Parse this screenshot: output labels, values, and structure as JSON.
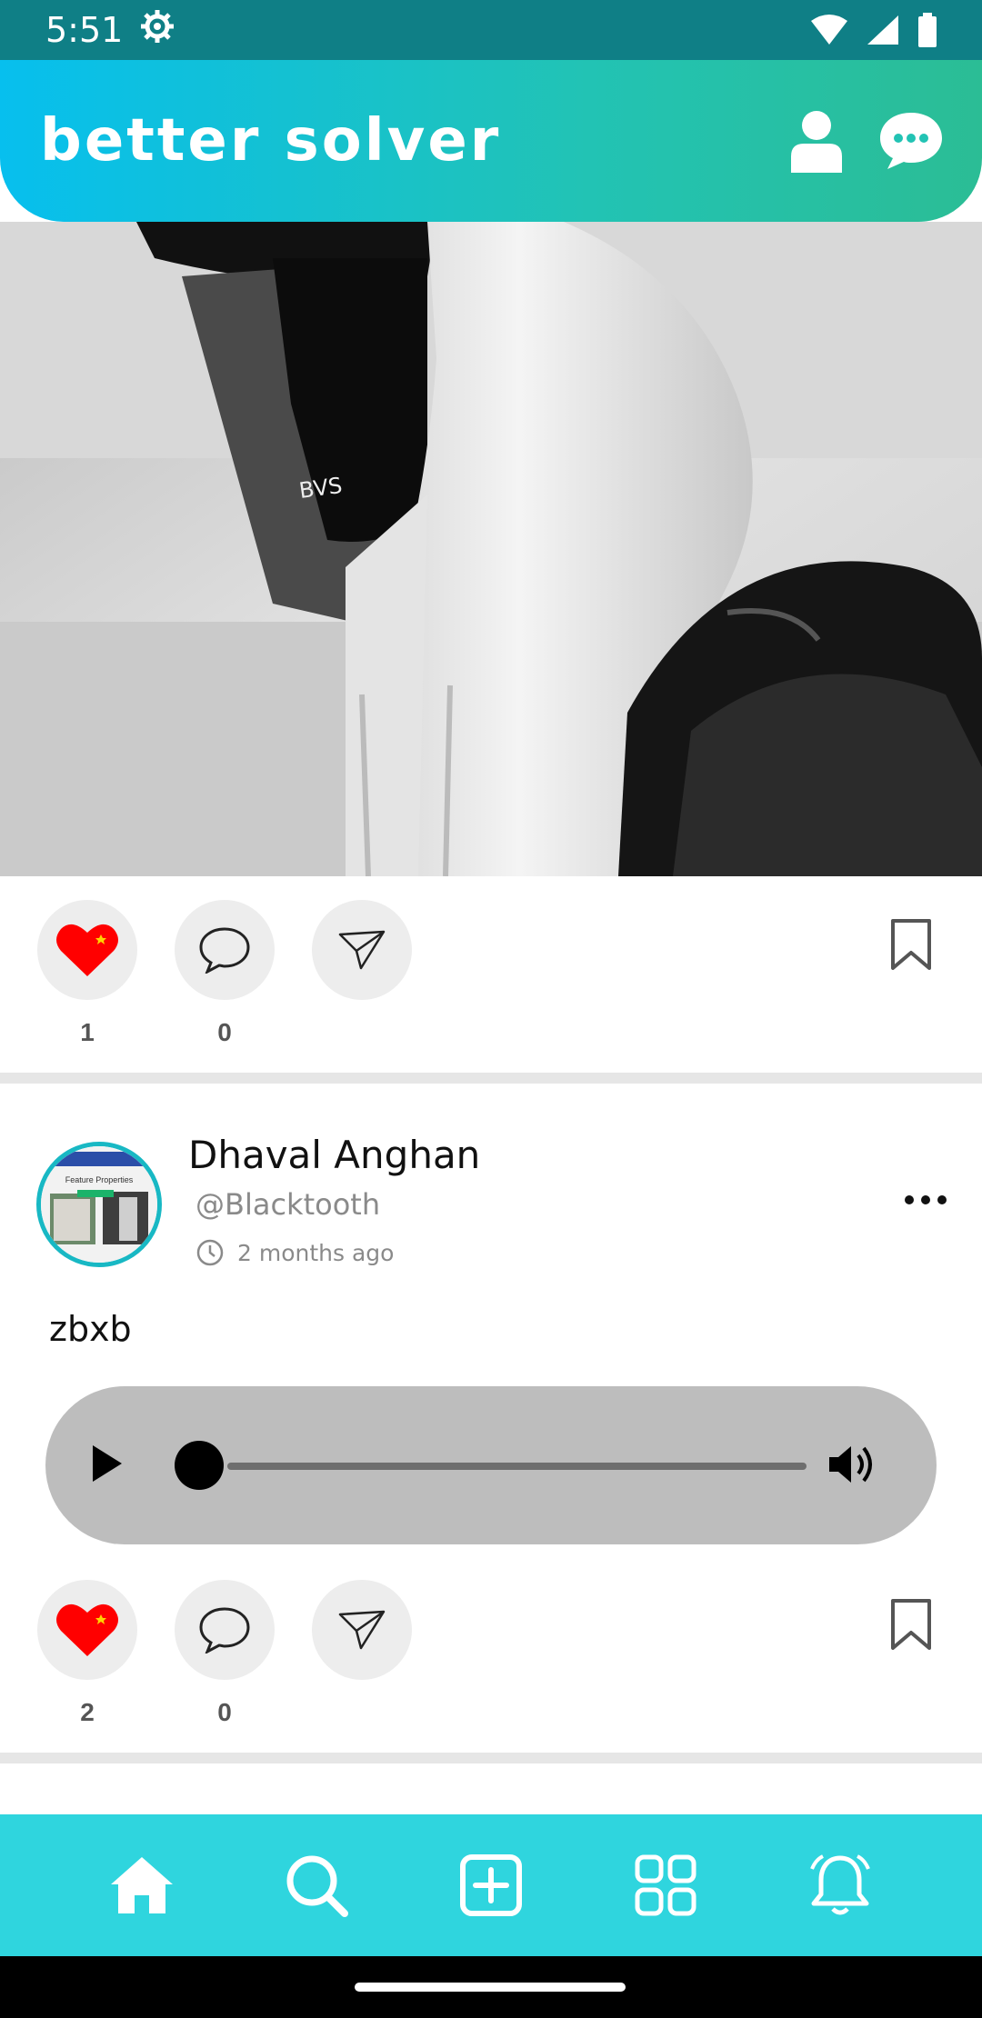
{
  "status_bar": {
    "time": "5:51",
    "icons": [
      "settings-icon",
      "wifi-icon",
      "signal-icon",
      "battery-icon"
    ]
  },
  "header": {
    "title": "better solver",
    "icons": [
      "profile-icon",
      "chat-icon"
    ]
  },
  "post1": {
    "image_alt": "Black and white photo of person in white hoodie and black mask",
    "mask_text": "BVS",
    "like_count": "1",
    "comment_count": "0"
  },
  "post2": {
    "author_name": "Dhaval Anghan",
    "author_handle": "@Blacktooth",
    "time": "2 months ago",
    "avatar_text": "Feature Properties",
    "text": "zbxb",
    "like_count": "2",
    "comment_count": "0"
  },
  "bottom_nav": {
    "items": [
      "home-icon",
      "search-icon",
      "add-post-icon",
      "apps-icon",
      "notifications-icon"
    ]
  },
  "colors": {
    "status_bar": "#0f7f86",
    "header_gradient_start": "#07bfee",
    "header_gradient_end": "#2bbd95",
    "nav_bg": "#2fd5de",
    "like_red": "#ff0000",
    "avatar_border": "#18b8c4"
  }
}
